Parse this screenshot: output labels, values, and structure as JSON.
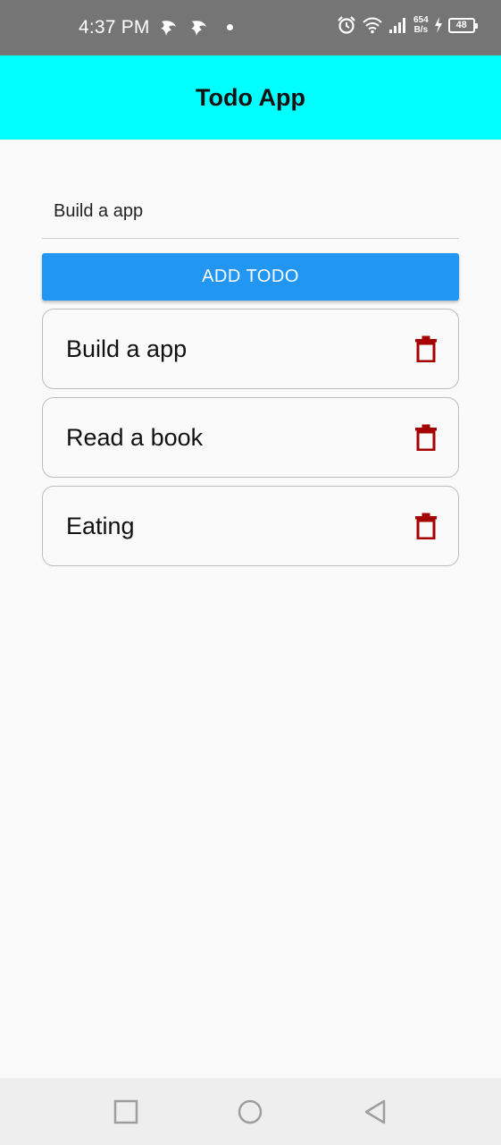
{
  "status_bar": {
    "time": "4:37 PM",
    "speed_value": "654",
    "speed_unit": "B/s",
    "battery": "48",
    "icons": [
      "notification-icon",
      "notification-icon",
      "alarm-icon",
      "wifi-icon",
      "signal-icon",
      "charging-icon",
      "battery-icon"
    ]
  },
  "app_bar": {
    "title": "Todo App"
  },
  "input": {
    "value": "Build a app"
  },
  "add_button": {
    "label": "ADD TODO"
  },
  "todos": [
    {
      "text": "Build a app"
    },
    {
      "text": "Read a book"
    },
    {
      "text": "Eating"
    }
  ],
  "colors": {
    "app_bar": "#00ffff",
    "button": "#2196f3",
    "delete_icon": "#a50000",
    "status_bar": "#757575"
  },
  "nav": {
    "icons": [
      "recents-icon",
      "home-icon",
      "back-icon"
    ]
  }
}
